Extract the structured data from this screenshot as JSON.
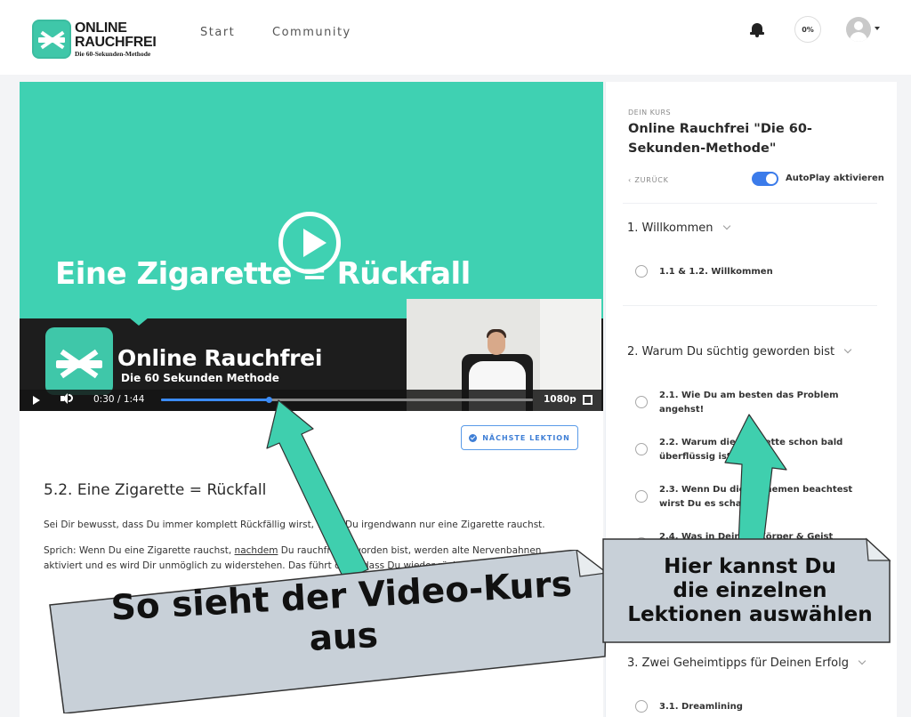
{
  "header": {
    "logo_line1": "ONLINE",
    "logo_line2": "RAUCHFREI",
    "logo_line3": "Die 60-Sekunden-Methode",
    "nav": [
      "Start",
      "Community"
    ],
    "progress": "0%"
  },
  "video": {
    "slide_title": "Eine Zigarette = Rückfall",
    "brand": "Online Rauchfrei",
    "brand_sub": "Die 60 Sekunden Methode",
    "time_current": "0:30",
    "time_sep": "/",
    "time_total": "1:44",
    "progress_fraction": 0.29,
    "quality": "1080p"
  },
  "lesson": {
    "next_label": "NÄCHSTE LEKTION",
    "heading": "5.2. Eine Zigarette = Rückfall",
    "para1": "Sei Dir bewusst, dass Du immer komplett Rückfällig wirst, wenn Du irgendwann nur eine Zigarette rauchst.",
    "para2_a": "Sprich: Wenn Du eine Zigarette rauchst, ",
    "para2_link": "nachdem",
    "para2_b": " Du rauchfrei geworden bist, werden alte Nervenbahnen aktiviert und es wird Dir unmöglich zu widerstehen. Das führt dazu, dass Du wieder rückfällig wirst."
  },
  "sidebar": {
    "kicker": "DEIN KURS",
    "title": "Online Rauchfrei \"Die 60-Sekunden-Methode\"",
    "back": "‹ ZURÜCK",
    "autoplay_label": "AutoPlay aktivieren",
    "sections": [
      {
        "title": "1. Willkommen",
        "items": [
          "1.1 & 1.2. Willkommen"
        ]
      },
      {
        "title": "2. Warum Du süchtig geworden bist",
        "items": [
          "2.1. Wie Du am besten das Problem angehst!",
          "2.2. Warum die Zigarette schon bald überflüssig ist",
          "2.3. Wenn Du diese Themen beachtest wirst Du es schaffen!",
          "2.4. Was in Deinem Körper & Geist passiert"
        ]
      },
      {
        "title": "3. Zwei Geheimtipps für Deinen Erfolg",
        "items": [
          "3.1. Dreamlining"
        ]
      }
    ]
  },
  "callouts": {
    "left_line1": "So sieht der Video-Kurs",
    "left_line2": "aus",
    "right_line1": "Hier kannst Du",
    "right_line2": "die einzelnen",
    "right_line3": "Lektionen auswählen"
  },
  "colors": {
    "teal": "#3fd1b2",
    "accent_blue": "#3b7bea",
    "arrow": "#3fcfae",
    "callout_fill": "#c8d0d8"
  }
}
